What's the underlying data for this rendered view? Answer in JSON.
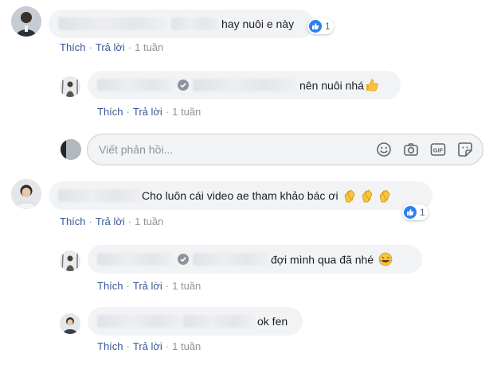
{
  "comments": [
    {
      "text": "hay nuôi e này",
      "reaction_count": "1",
      "actions": {
        "like": "Thích",
        "reply": "Trả lời",
        "time": "1 tuần"
      }
    },
    {
      "text": "nên nuôi nhá",
      "emoji": "thumbs-up-emoji",
      "actions": {
        "like": "Thích",
        "reply": "Trả lời",
        "time": "1 tuần"
      }
    },
    {
      "text": "Cho luôn cái video ae tham khảo bác ơi",
      "emoji": "clapping-hands-emoji",
      "reaction_count": "1",
      "actions": {
        "like": "Thích",
        "reply": "Trả lời",
        "time": "1 tuần"
      }
    },
    {
      "text": "đợi mình qua đã nhé",
      "emoji": "laughing-emoji",
      "actions": {
        "like": "Thích",
        "reply": "Trả lời",
        "time": "1 tuần"
      }
    },
    {
      "text": "ok fen",
      "actions": {
        "like": "Thích",
        "reply": "Trả lời",
        "time": "1 tuần"
      }
    }
  ],
  "reply_box": {
    "placeholder": "Viết phản hồi..."
  },
  "colors": {
    "link": "#385898",
    "bubble": "#f2f3f5",
    "like_badge": "#2e7ff5"
  },
  "icons": [
    "like-icon",
    "verified-badge-icon",
    "emoji-icon",
    "camera-icon",
    "gif-icon",
    "sticker-icon"
  ]
}
